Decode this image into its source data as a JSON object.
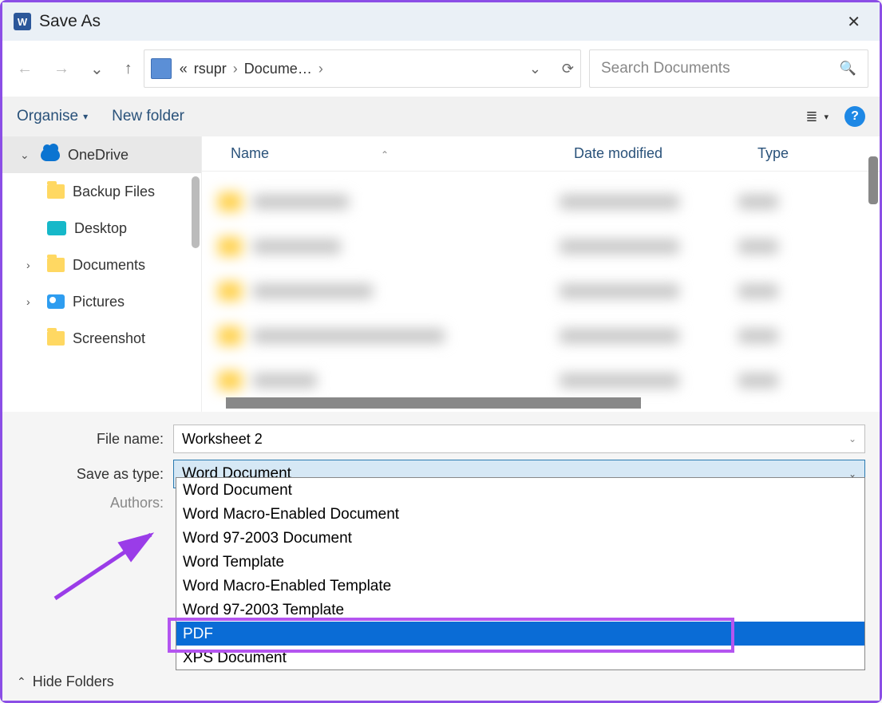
{
  "window": {
    "title": "Save As"
  },
  "address": {
    "locprefix": "«",
    "seg1": "rsupr",
    "seg2": "Docume…"
  },
  "search": {
    "placeholder": "Search Documents"
  },
  "toolbar": {
    "organise": "Organise",
    "newfolder": "New folder"
  },
  "tree": {
    "root": "OneDrive",
    "items": [
      "Backup Files",
      "Desktop",
      "Documents",
      "Pictures",
      "Screenshot"
    ]
  },
  "columns": {
    "name": "Name",
    "date": "Date modified",
    "type": "Type"
  },
  "fields": {
    "filename_label": "File name:",
    "filename_value": "Worksheet 2",
    "savetype_label": "Save as type:",
    "savetype_value": "Word Document",
    "authors_label": "Authors:"
  },
  "type_options": [
    "Word Document",
    "Word Macro-Enabled Document",
    "Word 97-2003 Document",
    "Word Template",
    "Word Macro-Enabled Template",
    "Word 97-2003 Template",
    "PDF",
    "XPS Document"
  ],
  "selected_type_index": 6,
  "footer": {
    "hide": "Hide Folders"
  }
}
